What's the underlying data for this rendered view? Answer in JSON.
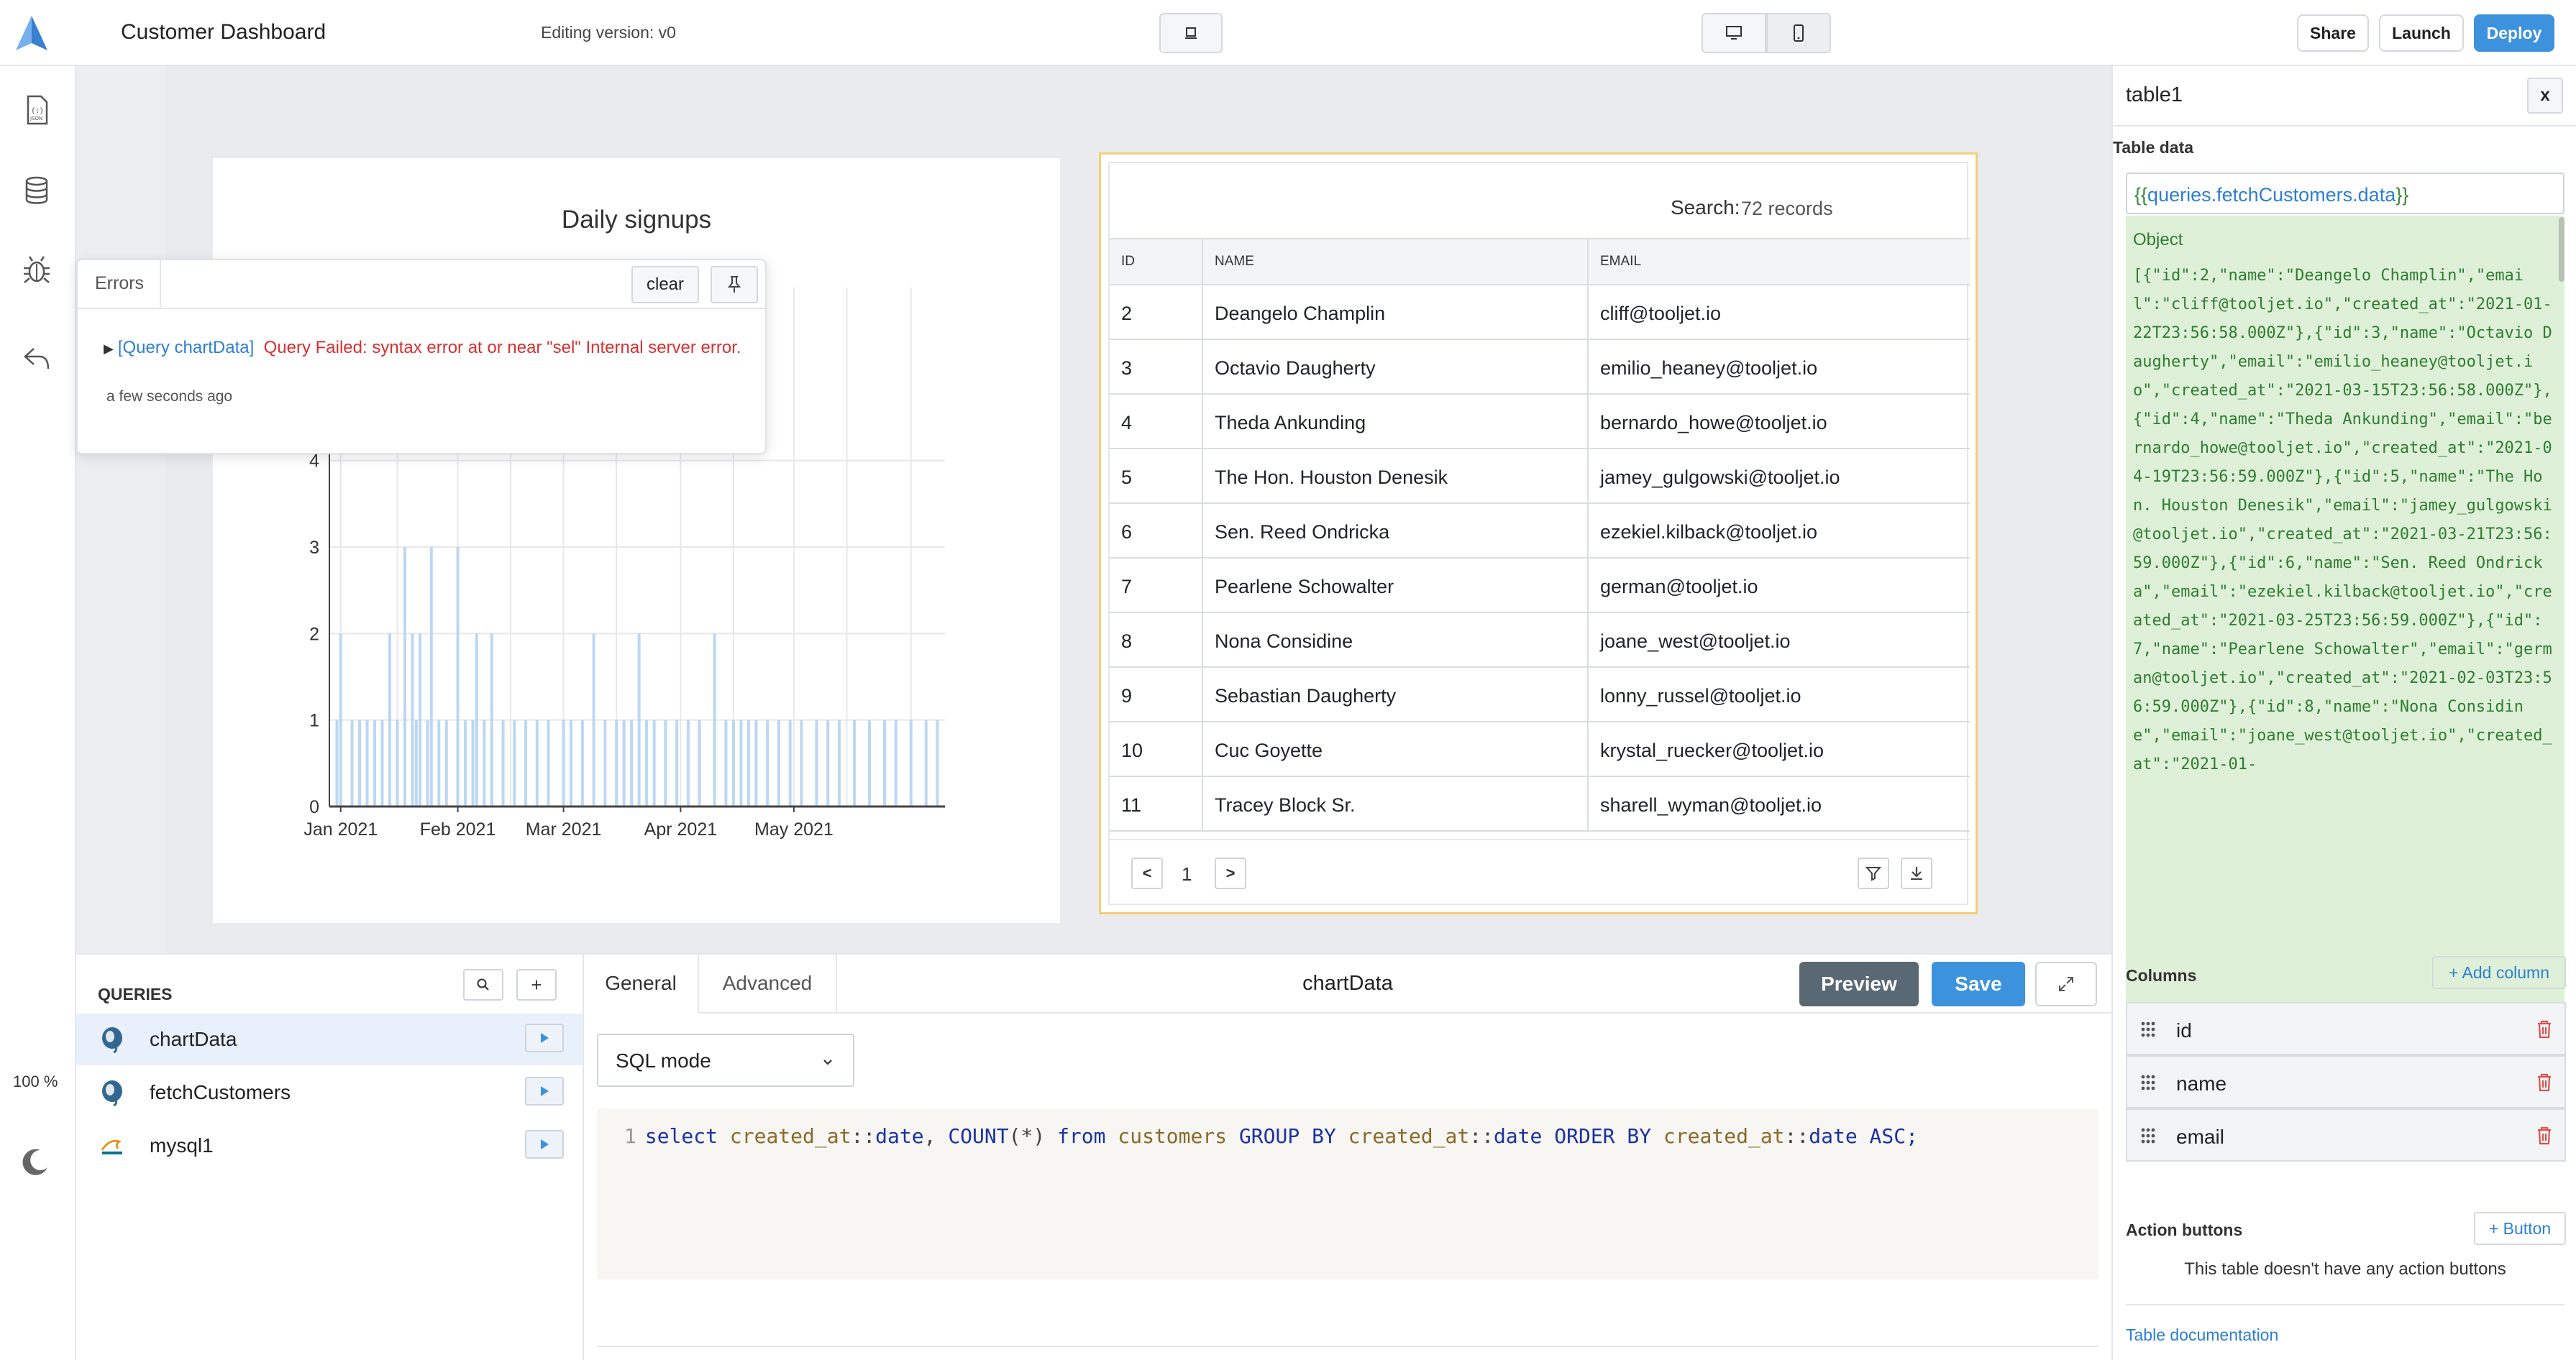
{
  "header": {
    "app_title": "Customer Dashboard",
    "editing_version": "Editing version: v0",
    "share_label": "Share",
    "launch_label": "Launch",
    "deploy_label": "Deploy"
  },
  "sidebar": {
    "zoom": "100 %",
    "items": [
      "inspector-icon",
      "database-icon",
      "debugger-icon",
      "undo-icon"
    ]
  },
  "chart": {
    "title": "Daily signups",
    "chart_data": {
      "type": "bar",
      "title": "Daily signups",
      "xlabel": "",
      "ylabel": "",
      "ylim": [
        0,
        6
      ],
      "x_ticks": [
        "Jan 2021",
        "Feb 2021",
        "Mar 2021",
        "Apr 2021",
        "May 2021"
      ],
      "y_ticks": [
        0,
        1,
        2,
        3,
        4
      ],
      "x_range": [
        "2020-12-29",
        "2021-06-10"
      ],
      "x": [
        "2020-12-31",
        "2021-01-01",
        "2021-01-04",
        "2021-01-06",
        "2021-01-08",
        "2021-01-10",
        "2021-01-12",
        "2021-01-14",
        "2021-01-16",
        "2021-01-18",
        "2021-01-20",
        "2021-01-21",
        "2021-01-22",
        "2021-01-24",
        "2021-01-25",
        "2021-01-27",
        "2021-01-29",
        "2021-02-01",
        "2021-02-03",
        "2021-02-05",
        "2021-02-06",
        "2021-02-08",
        "2021-02-10",
        "2021-02-13",
        "2021-02-16",
        "2021-02-19",
        "2021-02-22",
        "2021-02-25",
        "2021-03-01",
        "2021-03-03",
        "2021-03-06",
        "2021-03-09",
        "2021-03-12",
        "2021-03-15",
        "2021-03-17",
        "2021-03-19",
        "2021-03-21",
        "2021-03-23",
        "2021-03-25",
        "2021-03-28",
        "2021-03-31",
        "2021-04-03",
        "2021-04-06",
        "2021-04-10",
        "2021-04-13",
        "2021-04-15",
        "2021-04-17",
        "2021-04-19",
        "2021-04-21",
        "2021-04-24",
        "2021-04-27",
        "2021-04-30",
        "2021-05-03",
        "2021-05-07",
        "2021-05-10",
        "2021-05-13",
        "2021-05-17",
        "2021-05-21",
        "2021-05-25",
        "2021-05-28",
        "2021-06-01",
        "2021-06-05",
        "2021-06-08"
      ],
      "values": [
        1,
        2,
        1,
        1,
        1,
        1,
        1,
        2,
        1,
        3,
        2,
        1,
        2,
        1,
        3,
        1,
        1,
        3,
        1,
        1,
        2,
        1,
        2,
        1,
        1,
        1,
        1,
        1,
        1,
        1,
        1,
        2,
        1,
        1,
        1,
        1,
        2,
        1,
        1,
        1,
        1,
        1,
        1,
        2,
        1,
        1,
        1,
        1,
        1,
        1,
        1,
        1,
        1,
        1,
        1,
        1,
        1,
        1,
        1,
        1,
        1,
        1,
        1
      ]
    }
  },
  "errors": {
    "tab_label": "Errors",
    "clear_label": "clear",
    "source": "[Query chartData]",
    "message": "Query Failed: syntax error at or near \"sel\" Internal server error.",
    "time": "a few seconds ago"
  },
  "table": {
    "search_label": "Search:",
    "records": "72 records",
    "headers": [
      "ID",
      "NAME",
      "EMAIL"
    ],
    "rows": [
      [
        "2",
        "Deangelo Champlin",
        "cliff@tooljet.io"
      ],
      [
        "3",
        "Octavio Daugherty",
        "emilio_heaney@tooljet.io"
      ],
      [
        "4",
        "Theda Ankunding",
        "bernardo_howe@tooljet.io"
      ],
      [
        "5",
        "The Hon. Houston Denesik",
        "jamey_gulgowski@tooljet.io"
      ],
      [
        "6",
        "Sen. Reed Ondricka",
        "ezekiel.kilback@tooljet.io"
      ],
      [
        "7",
        "Pearlene Schowalter",
        "german@tooljet.io"
      ],
      [
        "8",
        "Nona Considine",
        "joane_west@tooljet.io"
      ],
      [
        "9",
        "Sebastian Daugherty",
        "lonny_russel@tooljet.io"
      ],
      [
        "10",
        "Cuc Goyette",
        "krystal_ruecker@tooljet.io"
      ],
      [
        "11",
        "Tracey Block Sr.",
        "sharell_wyman@tooljet.io"
      ]
    ],
    "page": "1",
    "prev_label": "<",
    "next_label": ">"
  },
  "queries": {
    "title": "QUERIES",
    "search_glyph": "⌕",
    "add_label": "+",
    "items": [
      {
        "label": "chartData",
        "source": "postgresql"
      },
      {
        "label": "fetchCustomers",
        "source": "postgresql"
      },
      {
        "label": "mysql1",
        "source": "mysql"
      }
    ]
  },
  "editor": {
    "tab_general": "General",
    "tab_advanced": "Advanced",
    "query_name": "chartData",
    "preview_label": "Preview",
    "save_label": "Save",
    "mode": "SQL mode",
    "code": {
      "line_no": "1",
      "parts": [
        {
          "t": "kw",
          "v": "select "
        },
        {
          "t": "col",
          "v": "created_at"
        },
        {
          "t": "pu",
          "v": "::"
        },
        {
          "t": "kw",
          "v": "date"
        },
        {
          "t": "pu",
          "v": ", "
        },
        {
          "t": "fn",
          "v": "COUNT"
        },
        {
          "t": "pu",
          "v": "(*) "
        },
        {
          "t": "kw",
          "v": "from "
        },
        {
          "t": "col",
          "v": "customers "
        },
        {
          "t": "kw",
          "v": "GROUP BY "
        },
        {
          "t": "col",
          "v": "created_at"
        },
        {
          "t": "pu",
          "v": "::"
        },
        {
          "t": "kw",
          "v": "date ORDER BY "
        },
        {
          "t": "col",
          "v": "created_at"
        },
        {
          "t": "pu",
          "v": "::"
        },
        {
          "t": "kw",
          "v": "date ASC;"
        }
      ]
    }
  },
  "inspector": {
    "title": "table1",
    "close_label": "x",
    "table_data_label": "Table data",
    "table_data_value": "{{queries.fetchCustomers.data}}",
    "preview_type": "Object",
    "preview_json": "[{\"id\":2,\"name\":\"Deangelo Champlin\",\"email\":\"cliff@tooljet.io\",\"created_at\":\"2021-01-22T23:56:58.000Z\"},{\"id\":3,\"name\":\"Octavio Daugherty\",\"email\":\"emilio_heaney@tooljet.io\",\"created_at\":\"2021-03-15T23:56:58.000Z\"},{\"id\":4,\"name\":\"Theda Ankunding\",\"email\":\"bernardo_howe@tooljet.io\",\"created_at\":\"2021-04-19T23:56:59.000Z\"},{\"id\":5,\"name\":\"The Hon. Houston Denesik\",\"email\":\"jamey_gulgowski@tooljet.io\",\"created_at\":\"2021-03-21T23:56:59.000Z\"},{\"id\":6,\"name\":\"Sen. Reed Ondricka\",\"email\":\"ezekiel.kilback@tooljet.io\",\"created_at\":\"2021-03-25T23:56:59.000Z\"},{\"id\":7,\"name\":\"Pearlene Schowalter\",\"email\":\"german@tooljet.io\",\"created_at\":\"2021-02-03T23:56:59.000Z\"},{\"id\":8,\"name\":\"Nona Considine\",\"email\":\"joane_west@tooljet.io\",\"created_at\":\"2021-01-",
    "columns_label": "Columns",
    "add_column_label": "+ Add column",
    "columns": [
      "id",
      "name",
      "email"
    ],
    "action_buttons_label": "Action buttons",
    "add_button_label": "+ Button",
    "no_actions_text": "This table doesn't have any action buttons",
    "doc_link": "Table documentation"
  },
  "colors": {
    "accent": "#3c92dc",
    "bar": "#bcd7f2",
    "error": "#d63031",
    "preview_bg": "#dff0d8",
    "selection_border": "#f4cf7a"
  }
}
